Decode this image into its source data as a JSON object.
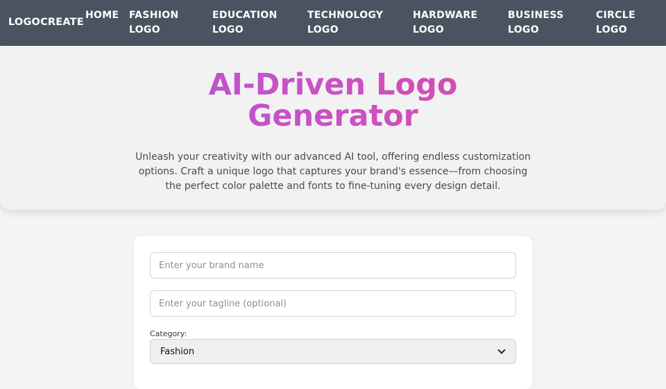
{
  "navbar": {
    "brand": "LOGOCREATE",
    "items": [
      {
        "line1": "HOME",
        "line2": ""
      },
      {
        "line1": "FASHION",
        "line2": "LOGO"
      },
      {
        "line1": "EDUCATION",
        "line2": "LOGO"
      },
      {
        "line1": "TECHNOLOGY",
        "line2": "LOGO"
      },
      {
        "line1": "HARDWARE",
        "line2": "LOGO"
      },
      {
        "line1": "BUSINESS",
        "line2": "LOGO"
      },
      {
        "line1": "CIRCLE",
        "line2": "LOGO"
      }
    ]
  },
  "hero": {
    "title_line1": "AI-Driven Logo",
    "title_line2": "Generator",
    "description": "Unleash your creativity with our advanced AI tool, offering endless customization options. Craft a unique logo that captures your brand's essence—from choosing the perfect color palette and fonts to fine-tuning every design detail."
  },
  "form": {
    "brand_name": {
      "value": "",
      "placeholder": "Enter your brand name"
    },
    "tagline": {
      "value": "",
      "placeholder": "Enter your tagline (optional)"
    },
    "category": {
      "label": "Category:",
      "selected": "Fashion"
    }
  },
  "colors": {
    "navbar_bg": "#4a535f",
    "title_gradient_start": "#a259d9",
    "title_gradient_end": "#e0489a"
  }
}
